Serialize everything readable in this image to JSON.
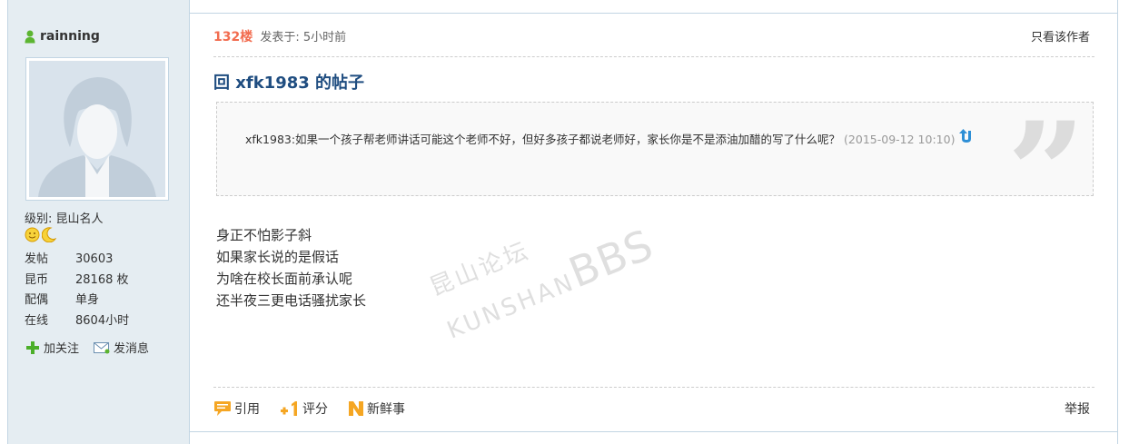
{
  "user": {
    "name": "rainning",
    "level": "级别: 昆山名人",
    "stats": [
      {
        "key": "发帖",
        "value": "30603"
      },
      {
        "key": "昆币",
        "value": "28168 枚"
      },
      {
        "key": "配偶",
        "value": "单身"
      },
      {
        "key": "在线",
        "value": "8604小时"
      }
    ],
    "follow_label": "加关注",
    "message_label": "发消息"
  },
  "post": {
    "floor": "132楼",
    "posted": "发表于: 5小时前",
    "author_only": "只看该作者",
    "title": "回 xfk1983 的帖子",
    "quote": {
      "text": "xfk1983:如果一个孩子帮老师讲话可能这个老师不好，但好多孩子都说老师好，家长你是不是添油加醋的写了什么呢？",
      "date": "(2015-09-12 10:10)"
    },
    "lines": [
      "身正不怕影子斜",
      "如果家长说的是假话",
      "为啥在校长面前承认呢",
      "还半夜三更电话骚扰家长"
    ]
  },
  "watermark": {
    "cn": "昆山论坛",
    "en": "KUNSHAN",
    "bbs": "BBS"
  },
  "footer": {
    "quote_label": "引用",
    "rate_label": "评分",
    "fresh_label": "新鲜事",
    "report_label": "举报"
  },
  "colors": {
    "floor": "#f26c4f",
    "title": "#1f4d80",
    "sidebar": "#e5edf2",
    "border": "#c2d5e3"
  }
}
